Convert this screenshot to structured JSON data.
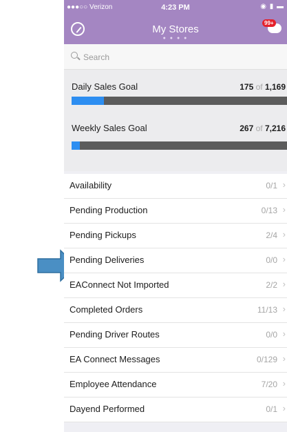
{
  "status_bar": {
    "carrier": "●●●○○ Verizon",
    "time": "4:23 PM"
  },
  "navbar": {
    "title": "My Stores",
    "notification_badge": "99+"
  },
  "search": {
    "placeholder": "Search"
  },
  "goals": [
    {
      "label": "Daily Sales Goal",
      "current": "175",
      "of": "of",
      "total": "1,169",
      "progress": 0.15
    },
    {
      "label": "Weekly Sales Goal",
      "current": "267",
      "of": "of",
      "total": "7,216",
      "progress": 0.037
    }
  ],
  "list": [
    {
      "label": "Availability",
      "value": "0/1"
    },
    {
      "label": "Pending Production",
      "value": "0/13"
    },
    {
      "label": "Pending Pickups",
      "value": "2/4"
    },
    {
      "label": "Pending Deliveries",
      "value": "0/0"
    },
    {
      "label": "EAConnect Not Imported",
      "value": "2/2"
    },
    {
      "label": "Completed Orders",
      "value": "11/13"
    },
    {
      "label": "Pending Driver Routes",
      "value": "0/0"
    },
    {
      "label": "EA Connect Messages",
      "value": "0/129"
    },
    {
      "label": "Employee Attendance",
      "value": "7/20"
    },
    {
      "label": "Dayend Performed",
      "value": "0/1"
    }
  ],
  "colors": {
    "header": "#a486c2",
    "progress_fill": "#2d8ef1",
    "progress_track": "#5c5c5c",
    "badge": "#e5212b",
    "arrow": "#4a8fc4"
  }
}
